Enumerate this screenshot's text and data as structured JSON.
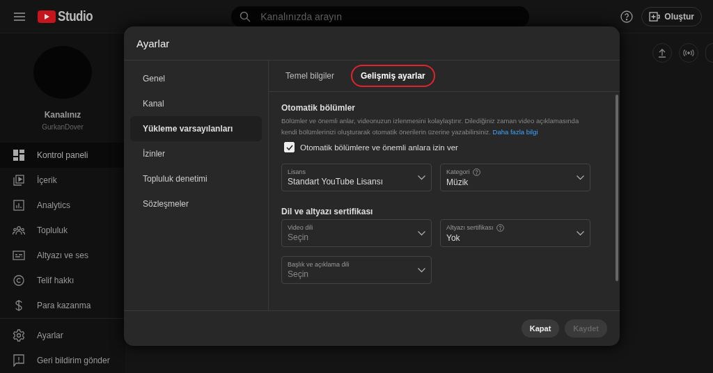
{
  "header": {
    "logo_text": "Studio",
    "search": {
      "placeholder": "Kanalınızda arayın"
    },
    "create_button": "Oluştur"
  },
  "channel": {
    "title": "Kanalınız",
    "name": "GurkanDover"
  },
  "sidebar": {
    "items": [
      {
        "label": "Kontrol paneli",
        "kind": "dashboard",
        "selected": true
      },
      {
        "label": "İçerik",
        "kind": "content",
        "selected": false
      },
      {
        "label": "Analytics",
        "kind": "analytics",
        "selected": false
      },
      {
        "label": "Topluluk",
        "kind": "community",
        "selected": false
      },
      {
        "label": "Altyazı ve ses",
        "kind": "subtitles",
        "selected": false
      },
      {
        "label": "Telif hakkı",
        "kind": "copyright",
        "selected": false
      },
      {
        "label": "Para kazanma",
        "kind": "money",
        "selected": false
      }
    ],
    "bottom_items": [
      {
        "label": "Ayarlar",
        "kind": "gear"
      },
      {
        "label": "Geri bildirim gönder",
        "kind": "feedback"
      }
    ]
  },
  "dialog": {
    "title": "Ayarlar",
    "nav": [
      {
        "label": "Genel",
        "selected": false
      },
      {
        "label": "Kanal",
        "selected": false
      },
      {
        "label": "Yükleme varsayılanları",
        "selected": true
      },
      {
        "label": "İzinler",
        "selected": false
      },
      {
        "label": "Topluluk denetimi",
        "selected": false
      },
      {
        "label": "Sözleşmeler",
        "selected": false
      }
    ],
    "tabs": [
      {
        "label": "Temel bilgiler",
        "selected": false,
        "circled": false
      },
      {
        "label": "Gelişmiş ayarlar",
        "selected": true,
        "circled": true
      }
    ],
    "sections": [
      {
        "heading": "Otomatik bölümler",
        "description": "Bölümler ve önemli anlar, videonuzun izlenmesini kolaylaştırır. Dilediğiniz zaman video açıklamasında kendi bölümlerinizi oluşturarak otomatik önerilerin üzerine yazabilirsiniz.",
        "link": "Daha fazla bilgi",
        "checkbox": {
          "label": "Otomatik bölümlere ve önemli anlara izin ver",
          "checked": true
        },
        "fields": [
          {
            "label": "Lisans",
            "value": "Standart YouTube Lisansı",
            "help": false
          },
          {
            "label": "Kategori",
            "value": "Müzik",
            "help": true
          }
        ]
      },
      {
        "heading": "Dil ve altyazı sertifikası",
        "fields": [
          {
            "label": "Video dili",
            "placeholder": "Seçin",
            "help": false
          },
          {
            "label": "Altyazı sertifikası",
            "value": "Yok",
            "help": true
          },
          {
            "label": "Başlık ve açıklama dili",
            "placeholder": "Seçin",
            "help": false
          }
        ]
      }
    ],
    "buttons": [
      {
        "label": "Kapat",
        "disabled": false
      },
      {
        "label": "Kaydet",
        "disabled": true
      }
    ]
  }
}
